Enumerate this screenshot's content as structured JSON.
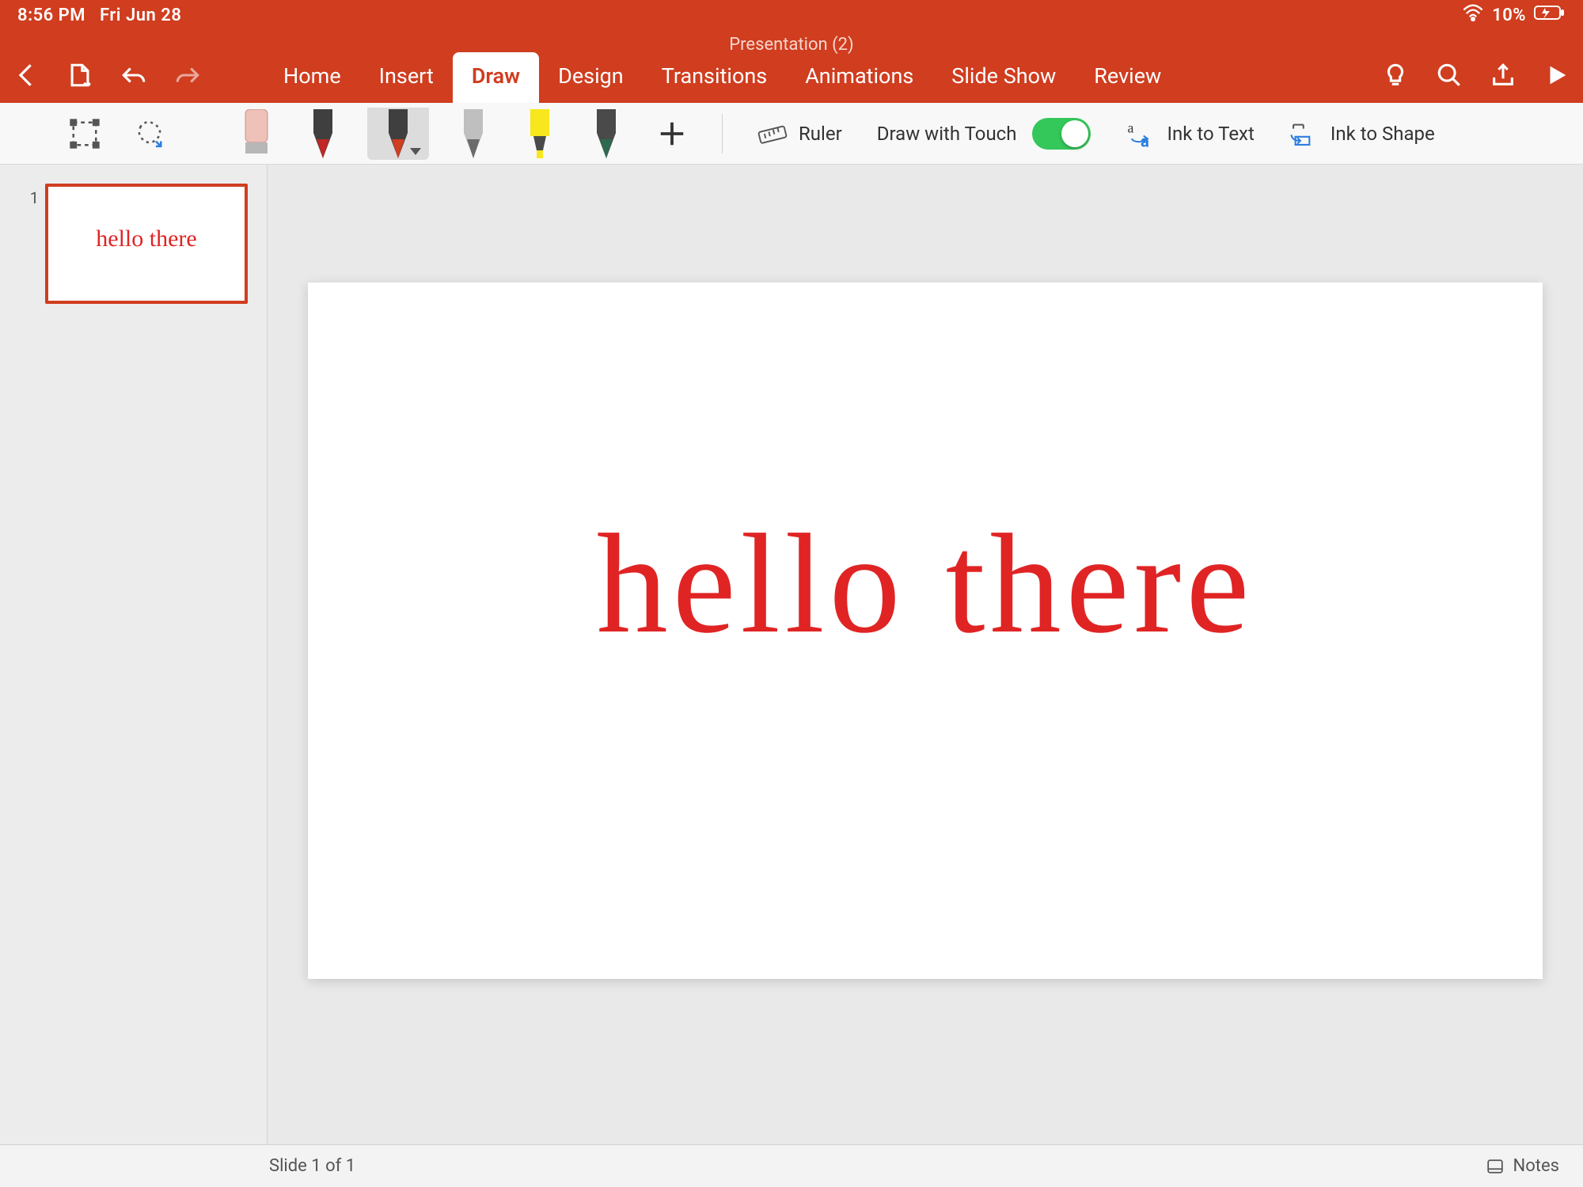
{
  "status": {
    "time": "8:56 PM",
    "date": "Fri Jun 28",
    "battery_pct": "10%"
  },
  "header": {
    "doc_title": "Presentation (2)",
    "tabs": [
      "Home",
      "Insert",
      "Draw",
      "Design",
      "Transitions",
      "Animations",
      "Slide Show",
      "Review"
    ],
    "active_tab": "Draw"
  },
  "ribbon": {
    "ruler_label": "Ruler",
    "draw_touch_label": "Draw with Touch",
    "draw_touch_on": true,
    "ink_to_text_label": "Ink to Text",
    "ink_to_shape_label": "Ink to Shape",
    "pen_colors": [
      "#e2b0a6",
      "#c02626",
      "#d03d1f",
      "#9a9a9a",
      "#f8e71c",
      "#2d6a4f"
    ]
  },
  "slides": {
    "thumbnail_index": "1",
    "handwritten_text": "hello there"
  },
  "footer": {
    "slide_count": "Slide 1 of 1",
    "notes_label": "Notes"
  },
  "colors": {
    "brand": "#d03d1f",
    "ink": "#e02424",
    "toggle_on": "#34c759"
  }
}
